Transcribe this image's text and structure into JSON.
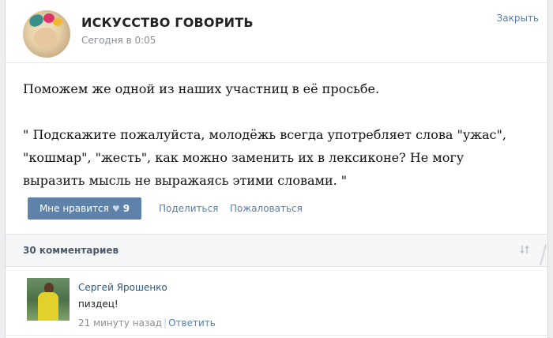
{
  "post": {
    "group_name": "ИСКУССТВО ГОВОРИТЬ",
    "time": "Сегодня в 0:05",
    "close_label": "Закрыть",
    "text_line1": "Поможем же одной из наших участниц в её просьбе.",
    "text_quote_l1": "\" Подскажите пожалуйста, молодёжь всегда употребляет слова \"ужас\",",
    "text_quote_l2": "\"кошмар\", \"жесть\", как можно заменить их в лексиконе? Не могу",
    "text_quote_l3": "выразить мысль не выражаясь этими словами. \"",
    "like_label": "Мне нравится",
    "like_count": "9",
    "share_label": "Поделиться",
    "report_label": "Пожаловаться"
  },
  "comments": {
    "count_label": "30 комментариев",
    "items": [
      {
        "author": "Сергей Ярошенко",
        "text": "пиздец!",
        "time": "21 минуту назад",
        "reply_label": "Ответить"
      }
    ]
  },
  "icons": {
    "like": "heart-icon",
    "sort": "sort-icon"
  },
  "colors": {
    "accent": "#5e82a8",
    "link": "#5b7fa6",
    "author_link": "#2a5885",
    "muted": "#8a8f96"
  }
}
